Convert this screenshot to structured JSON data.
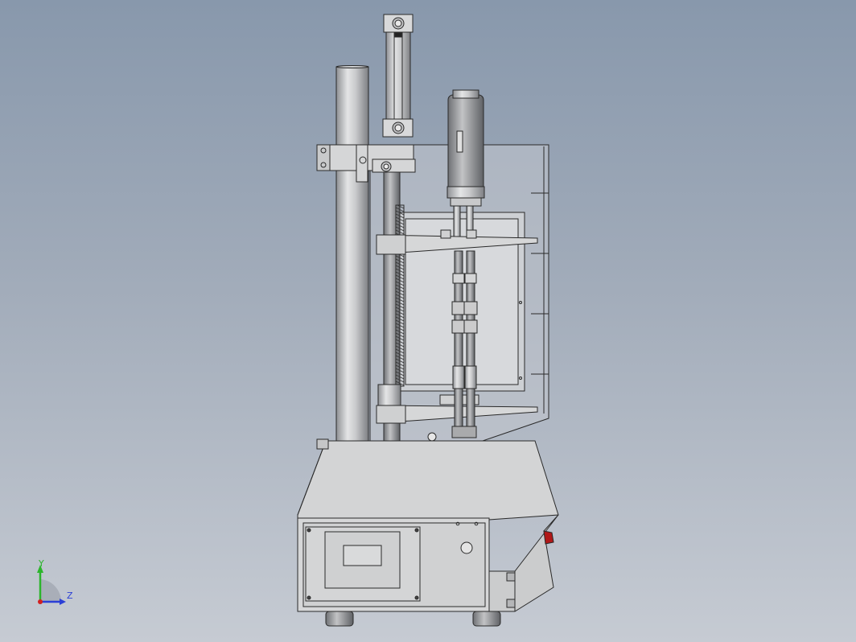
{
  "viewport": {
    "background_top": "#8898ac",
    "background_bottom": "#c6cbd3",
    "model_stroke": "#2a2a2a",
    "model_fill": "#d2d3d4",
    "indicator_red": "#b01818"
  },
  "triad": {
    "y_label": "Y",
    "z_label": "Z",
    "y_color": "#2cb52c",
    "z_color": "#2b3fd6",
    "origin_color": "#d22020"
  }
}
